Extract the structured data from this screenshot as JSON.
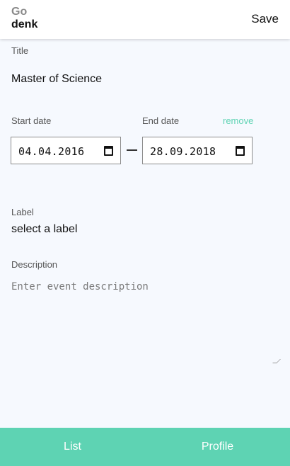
{
  "header": {
    "logo_top": "Go",
    "logo_bottom": "denk",
    "save_label": "Save"
  },
  "form": {
    "title": {
      "label": "Title",
      "value": "Master of Science"
    },
    "start_date": {
      "label": "Start date",
      "value": "04.04.2016"
    },
    "end_date": {
      "label": "End date",
      "value": "28.09.2018"
    },
    "remove_label": "remove",
    "label_field": {
      "label": "Label",
      "value": "select a label"
    },
    "description": {
      "label": "Description",
      "placeholder": "Enter event description"
    }
  },
  "bottom_nav": {
    "list_label": "List",
    "profile_label": "Profile"
  },
  "colors": {
    "accent": "#5ed3b3",
    "background": "#f6f9fe"
  },
  "icons": {
    "date_picker": "calendar-icon",
    "textarea_resize": "resize-handle-icon"
  }
}
